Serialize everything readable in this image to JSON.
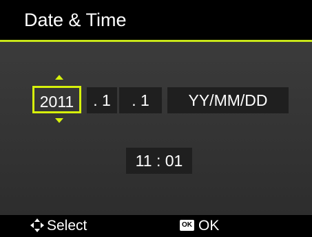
{
  "header": {
    "title": "Date & Time"
  },
  "date": {
    "year": "2011",
    "month": ". 1",
    "day": ". 1",
    "format": "YY/MM/DD"
  },
  "time": {
    "value": "11 : 01"
  },
  "footer": {
    "select_label": "Select",
    "ok_badge": "OK",
    "ok_label": "OK"
  },
  "colors": {
    "accent": "#d7f20b",
    "field_bg": "#1f1f1f"
  }
}
